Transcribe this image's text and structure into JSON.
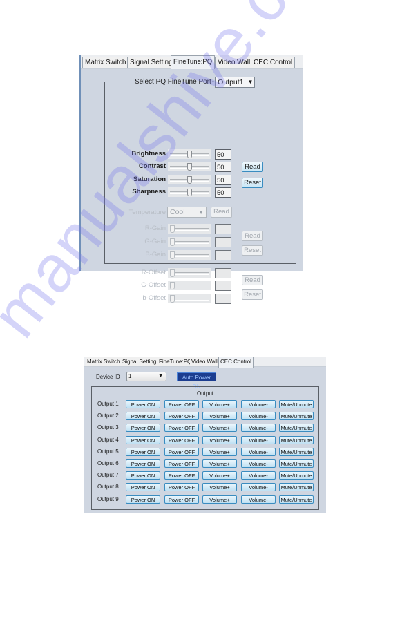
{
  "finetune_panel": {
    "tabs": [
      {
        "label": "Matrix Switch",
        "active": false
      },
      {
        "label": "Signal Setting",
        "active": false
      },
      {
        "label": "FineTune:PQ",
        "active": true
      },
      {
        "label": "Video Wall",
        "active": false
      },
      {
        "label": "CEC Control",
        "active": false
      }
    ],
    "port_select_label": "Select PQ FineTune Port",
    "port_select_value": "Output1",
    "picture_controls": [
      {
        "label": "Brightness",
        "value": "50",
        "slider_fraction": 0.5,
        "enabled": true
      },
      {
        "label": "Contrast",
        "value": "50",
        "slider_fraction": 0.5,
        "enabled": true
      },
      {
        "label": "Saturation",
        "value": "50",
        "slider_fraction": 0.5,
        "enabled": true
      },
      {
        "label": "Sharpness",
        "value": "50",
        "slider_fraction": 0.5,
        "enabled": true
      }
    ],
    "picture_read_label": "Read",
    "picture_reset_label": "Reset",
    "temperature_label": "Temperature",
    "temperature_value": "Cool",
    "temperature_read_label": "Read",
    "gain_controls": [
      {
        "label": "R-Gain",
        "value": "",
        "slider_fraction": 0,
        "enabled": false
      },
      {
        "label": "G-Gain",
        "value": "",
        "slider_fraction": 0,
        "enabled": false
      },
      {
        "label": "B-Gain",
        "value": "",
        "slider_fraction": 0,
        "enabled": false
      }
    ],
    "gain_read_label": "Read",
    "gain_reset_label": "Reset",
    "offset_controls": [
      {
        "label": "R-Offset",
        "value": "",
        "slider_fraction": 0,
        "enabled": false
      },
      {
        "label": "G-Offset",
        "value": "",
        "slider_fraction": 0,
        "enabled": false
      },
      {
        "label": "b-Offset",
        "value": "",
        "slider_fraction": 0,
        "enabled": false
      }
    ],
    "offset_read_label": "Read",
    "offset_reset_label": "Reset"
  },
  "cec_panel": {
    "tabs": [
      {
        "label": "Matrix Switch",
        "active": false
      },
      {
        "label": "Signal Setting",
        "active": false
      },
      {
        "label": "FineTune:PQ",
        "active": false
      },
      {
        "label": "Video Wall",
        "active": false
      },
      {
        "label": "CEC Control",
        "active": true
      }
    ],
    "device_id_label": "Device ID",
    "device_id_value": "1",
    "auto_power_label": "Auto Power ON",
    "output_group_title": "Output",
    "button_labels": [
      "Power ON",
      "Power OFF",
      "Volume+",
      "Volume-",
      "Mute/Unmute"
    ],
    "outputs": [
      "Output 1",
      "Output 2",
      "Output 3",
      "Output 4",
      "Output 5",
      "Output 6",
      "Output 7",
      "Output 8",
      "Output 9"
    ]
  },
  "watermark": "manualshive.com",
  "colors": {
    "panel_bg": "#cfd6e1",
    "button_border": "#3a8cc0",
    "auto_power_bg": "#1c3d8f"
  }
}
